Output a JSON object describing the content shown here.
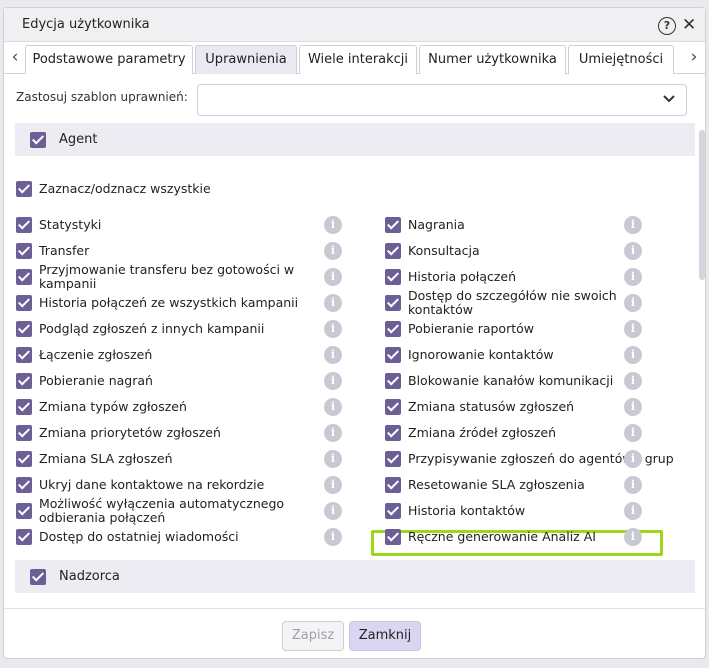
{
  "dialog": {
    "title": "Edycja użytkownika"
  },
  "tabs": [
    {
      "label": "Podstawowe parametry"
    },
    {
      "label": "Uprawnienia"
    },
    {
      "label": "Wiele interakcji"
    },
    {
      "label": "Numer użytkownika"
    },
    {
      "label": "Umiejętności"
    }
  ],
  "template": {
    "label": "Zastosuj szablon uprawnień:",
    "value": ""
  },
  "sections": {
    "agent": "Agent",
    "supervisor": "Nadzorca"
  },
  "select_all": "Zaznacz/odznacz wszystkie",
  "left_perms": [
    "Statystyki",
    "Transfer",
    "Przyjmowanie transferu bez gotowości w kampanii",
    "Historia połączeń ze wszystkich kampanii",
    "Podgląd zgłoszeń z innych kampanii",
    "Łączenie zgłoszeń",
    "Pobieranie nagrań",
    "Zmiana typów zgłoszeń",
    "Zmiana priorytetów zgłoszeń",
    "Zmiana SLA zgłoszeń",
    "Ukryj dane kontaktowe na rekordzie",
    "Możliwość wyłączenia automatycznego odbierania połączeń",
    "Dostęp do ostatniej wiadomości"
  ],
  "right_perms": [
    "Nagrania",
    "Konsultacja",
    "Historia połączeń",
    "Dostęp do szczegółów nie swoich kontaktów",
    "Pobieranie raportów",
    "Ignorowanie kontaktów",
    "Blokowanie kanałów komunikacji",
    "Zmiana statusów zgłoszeń",
    "Zmiana źródeł zgłoszeń",
    "Przypisywanie zgłoszeń do agentów / grup",
    "Resetowanie SLA zgłoszenia",
    "Historia kontaktów",
    "Ręczne generowanie Analiz AI"
  ],
  "buttons": {
    "save": "Zapisz",
    "close": "Zamknij"
  },
  "icons": {
    "info": "i",
    "help": "?",
    "close": "✕",
    "prev": "‹",
    "next": "›",
    "chevron": "⌄"
  },
  "colors": {
    "checkbox": "#6c5f95",
    "highlight": "#9ed61c",
    "primary_button": "#d9d6f2"
  }
}
